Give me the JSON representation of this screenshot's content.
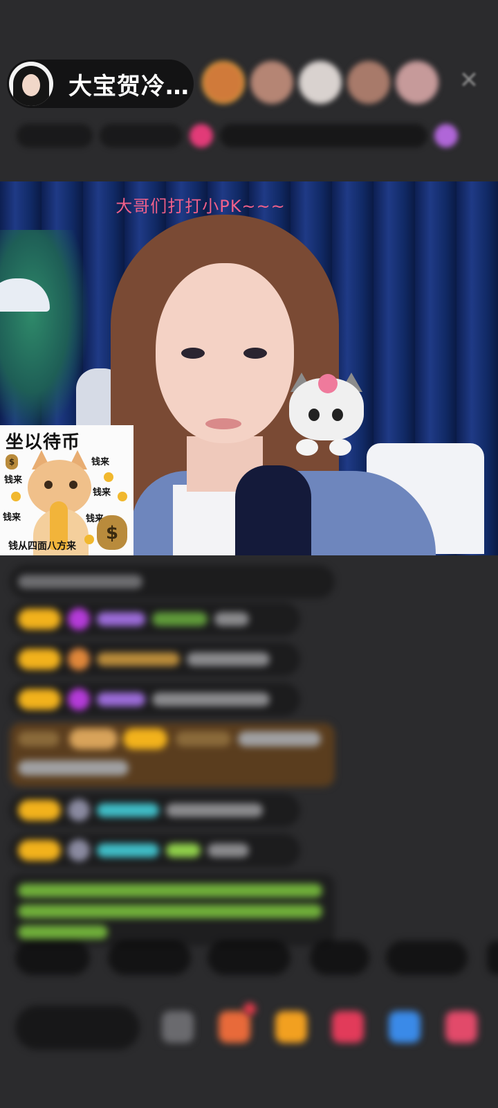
{
  "header": {
    "host_name": "大宝贺冷…",
    "close_icon": "close-icon"
  },
  "stream": {
    "caption": "大哥们打打小PK~~~"
  },
  "sticker": {
    "title": "坐以待币",
    "words": [
      "钱来",
      "钱来",
      "钱来",
      "钱来",
      "钱来"
    ],
    "bottom_text": "钱从四面八方来",
    "bag_symbol": "$"
  },
  "colors": {
    "background": "#2b2b2d",
    "caption": "#f0608a",
    "badge_gold": "#f2b21c",
    "name_purple": "#9b6bd8",
    "name_cyan": "#3fbcc6",
    "name_green": "#8fcf4a"
  }
}
